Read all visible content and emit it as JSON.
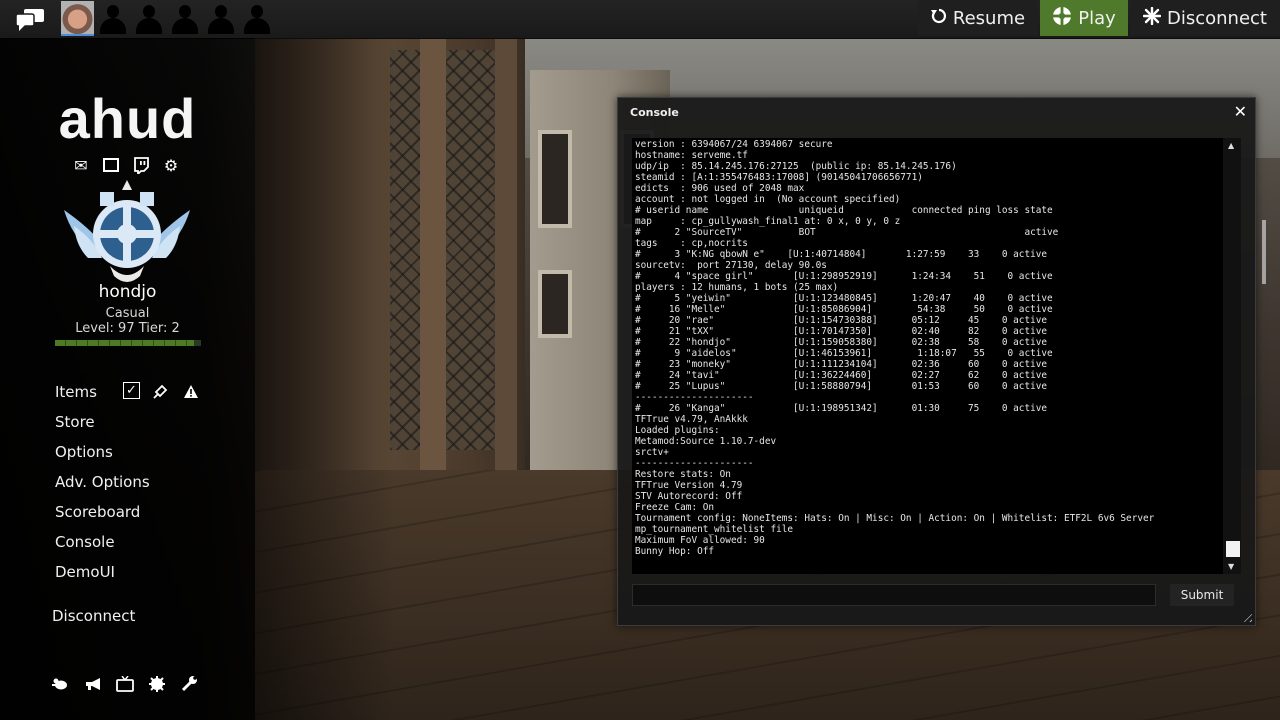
{
  "topbar": {
    "resume_label": "Resume",
    "play_label": "Play",
    "disconnect_label": "Disconnect",
    "play_color": "#4f7a2c"
  },
  "sidebar": {
    "logo": "ahud",
    "player": {
      "name": "hondjo",
      "mode": "Casual",
      "level_text": "Level: 97 Tier: 2",
      "xp_fraction": 0.95
    },
    "menu": [
      {
        "label": "Items"
      },
      {
        "label": "Store"
      },
      {
        "label": "Options"
      },
      {
        "label": "Adv. Options"
      },
      {
        "label": "Scoreboard"
      },
      {
        "label": "Console"
      },
      {
        "label": "DemoUI"
      }
    ],
    "disconnect_label": "Disconnect"
  },
  "console": {
    "title": "Console",
    "close_glyph": "✕",
    "submit_label": "Submit",
    "input_value": "",
    "output": "version : 6394067/24 6394067 secure\nhostname: serveme.tf\nudp/ip  : 85.14.245.176:27125  (public ip: 85.14.245.176)\nsteamid : [A:1:355476483:17008] (90145041706656771)\nedicts  : 906 used of 2048 max\naccount : not logged in  (No account specified)\n# userid name                uniqueid            connected ping loss state\nmap     : cp_gullywash_final1 at: 0 x, 0 y, 0 z\n#      2 \"SourceTV\"          BOT                                     active\ntags    : cp,nocrits\n#      3 \"K:NG qbowN e\"    [U:1:40714804]       1:27:59    33    0 active\nsourcetv:  port 27130, delay 90.0s\n#      4 \"space girl\"       [U:1:298952919]      1:24:34    51    0 active\nplayers : 12 humans, 1 bots (25 max)\n#      5 \"yeiwin\"           [U:1:123480845]      1:20:47    40    0 active\n#     16 \"Melle\"            [U:1:85086904]        54:38     50    0 active\n#     20 \"rae\"              [U:1:154730388]      05:12     45    0 active\n#     21 \"tXX\"              [U:1:70147350]       02:40     82    0 active\n#     22 \"hondjo\"           [U:1:159058380]      02:38     58    0 active\n#      9 \"aidelos\"          [U:1:46153961]        1:18:07   55    0 active\n#     23 \"moneky\"           [U:1:111234104]      02:36     60    0 active\n#     24 \"tavi\"             [U:1:36224460]       02:27     62    0 active\n#     25 \"Lupus\"            [U:1:58880794]       01:53     60    0 active\n---------------------\n#     26 \"Kanga\"            [U:1:198951342]      01:30     75    0 active\nTFTrue v4.79, AnAkkk\nLoaded plugins:\nMetamod:Source 1.10.7-dev\nsrctv+\n---------------------\nRestore stats: On\nTFTrue Version 4.79\nSTV Autorecord: Off\nFreeze Cam: On\nTournament config: NoneItems: Hats: On | Misc: On | Action: On | Whitelist: ETF2L 6v6 Server\nmp_tournament_whitelist file\nMaximum FoV allowed: 90\nBunny Hop: Off"
  },
  "icons": {
    "chat": "chat-bubbles-icon",
    "mail": "mail-icon",
    "window": "window-icon",
    "twitch": "twitch-icon",
    "settings": "gear-icon",
    "items_check": "checkbox-icon",
    "items_craft": "hand-icon",
    "items_warning": "warning-icon"
  }
}
